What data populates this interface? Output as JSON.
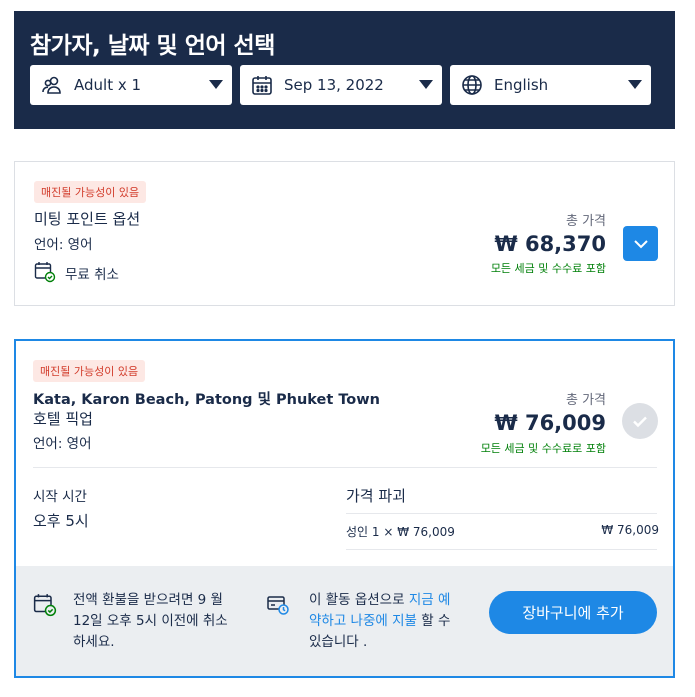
{
  "header": {
    "title": "참가자, 날짜 및 언어 선택",
    "participants": "Adult x 1",
    "date": "Sep 13, 2022",
    "language": "English"
  },
  "options": [
    {
      "badge": "매진될 가능성이 있음",
      "title": "미팅 포인트 옵션",
      "language": "언어: 영어",
      "cancellation": "무료 취소",
      "price_label": "총 가격",
      "price": "₩ 68,370",
      "tax_note": "모든 세금 및 수수료 포함"
    },
    {
      "badge": "매진될 가능성이 있음",
      "title_line1": "Kata, Karon Beach, Patong 및 Phuket Town",
      "title_line2": "호텔 픽업",
      "language": "언어: 영어",
      "price_label": "총 가격",
      "price": "₩ 76,009",
      "tax_note": "모든 세금 및 수수료로 포함",
      "start_time_label": "시작 시간",
      "start_time": "오후 5시",
      "breakdown_title": "가격 파괴",
      "breakdown_item": "성인 1 × ₩ 76,009",
      "breakdown_amount": "₩ 76,009",
      "refund_line1": "전액 환불을 받으려면 9 월",
      "refund_line2": "12일 오후 5시 이전에 취소",
      "refund_line3": "하세요.",
      "reserve_line1_a": "이 활동 옵션으로 ",
      "reserve_line1_b": "지금 예",
      "reserve_line2_a": "약하고 나중에 지불",
      "reserve_line2_b": " 할 수",
      "reserve_line3": "있습니다 .",
      "cart_button": "장바구니에 추가"
    }
  ],
  "colors": {
    "header_bg": "#1a2b49",
    "accent": "#1e88e5",
    "badge_bg": "#fde8e4",
    "badge_text": "#d23c2b",
    "tax_text": "#008009"
  }
}
